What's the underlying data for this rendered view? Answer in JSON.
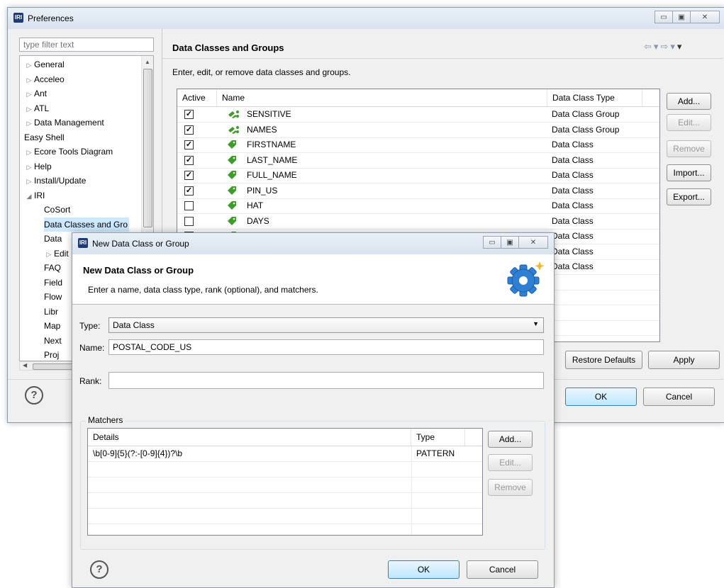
{
  "preferences": {
    "title": "Preferences",
    "filter_placeholder": "type filter text",
    "tree": [
      {
        "label": "General",
        "arrow": "▷"
      },
      {
        "label": "Acceleo",
        "arrow": "▷"
      },
      {
        "label": "Ant",
        "arrow": "▷"
      },
      {
        "label": "ATL",
        "arrow": "▷"
      },
      {
        "label": "Data Management",
        "arrow": "▷"
      },
      {
        "label": "Easy Shell",
        "arrow": ""
      },
      {
        "label": "Ecore Tools Diagram",
        "arrow": "▷"
      },
      {
        "label": "Help",
        "arrow": "▷"
      },
      {
        "label": "Install/Update",
        "arrow": "▷"
      },
      {
        "label": "IRI",
        "arrow": "◢"
      },
      {
        "label": "CoSort",
        "arrow": ""
      },
      {
        "label": "Data Classes and Gro",
        "arrow": "",
        "selected": true
      },
      {
        "label": "Data",
        "arrow": ""
      },
      {
        "label": "Edit",
        "arrow": "▷"
      },
      {
        "label": "FAQ",
        "arrow": ""
      },
      {
        "label": "Field",
        "arrow": ""
      },
      {
        "label": "Flow",
        "arrow": ""
      },
      {
        "label": "Libr",
        "arrow": ""
      },
      {
        "label": "Map",
        "arrow": ""
      },
      {
        "label": "Next",
        "arrow": ""
      },
      {
        "label": "Proj",
        "arrow": ""
      }
    ],
    "page_title": "Data Classes and Groups",
    "page_description": "Enter, edit, or remove data classes and groups.",
    "columns": [
      "Active",
      "Name",
      "Data Class Type"
    ],
    "rows": [
      {
        "active": true,
        "name": "SENSITIVE",
        "type": "Data Class Group",
        "kind": "group"
      },
      {
        "active": true,
        "name": "NAMES",
        "type": "Data Class Group",
        "kind": "group"
      },
      {
        "active": true,
        "name": "FIRSTNAME",
        "type": "Data Class",
        "kind": "class"
      },
      {
        "active": true,
        "name": "LAST_NAME",
        "type": "Data Class",
        "kind": "class"
      },
      {
        "active": true,
        "name": "FULL_NAME",
        "type": "Data Class",
        "kind": "class"
      },
      {
        "active": true,
        "name": "PIN_US",
        "type": "Data Class",
        "kind": "class"
      },
      {
        "active": false,
        "name": "HAT",
        "type": "Data Class",
        "kind": "class"
      },
      {
        "active": false,
        "name": "DAYS",
        "type": "Data Class",
        "kind": "class"
      },
      {
        "active": false,
        "name": "",
        "type": "Data Class",
        "kind": "class"
      },
      {
        "active": false,
        "name": "",
        "type": "Data Class",
        "kind": "class"
      },
      {
        "active": false,
        "name": "",
        "type": "Data Class",
        "kind": "class"
      }
    ],
    "buttons": {
      "add": "Add...",
      "edit": "Edit...",
      "remove": "Remove",
      "import": "Import...",
      "export": "Export..."
    },
    "restore_defaults": "Restore Defaults",
    "apply": "Apply",
    "ok": "OK",
    "cancel": "Cancel",
    "help_symbol": "?",
    "checkmark": "✓"
  },
  "dialog": {
    "title": "New Data Class or Group",
    "heading": "New Data Class or Group",
    "description": "Enter a name, data class type, rank (optional), and matchers.",
    "type_label": "Type:",
    "type_value": "Data Class",
    "name_label": "Name:",
    "name_value": "POSTAL_CODE_US",
    "rank_label": "Rank:",
    "rank_value": "",
    "matchers_label": "Matchers",
    "matcher_columns": [
      "Details",
      "Type"
    ],
    "matchers": [
      {
        "details": "\\b[0-9]{5}(?:-[0-9]{4})?\\b",
        "type": "PATTERN"
      }
    ],
    "buttons": {
      "add": "Add...",
      "edit": "Edit...",
      "remove": "Remove"
    },
    "ok": "OK",
    "cancel": "Cancel",
    "help_symbol": "?"
  },
  "window_controls": {
    "minimize": "▭",
    "maximize": "▣",
    "close": "✕"
  },
  "app_icon": "IRI",
  "colors": {
    "leaf_green": "#3f9b2a",
    "selection": "#cce8ff",
    "gear_blue": "#2f7fd3"
  }
}
